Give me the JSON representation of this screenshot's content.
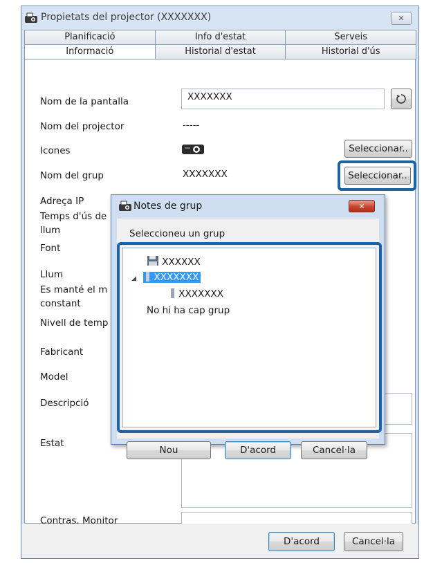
{
  "window": {
    "title": "Propietats del projector (XXXXXXX)",
    "close_glyph": "✕"
  },
  "tabs": {
    "row1": [
      "Planificació",
      "Info d'estat",
      "Serveis"
    ],
    "row2": [
      "Informació",
      "Historial d'estat",
      "Historial d'ús"
    ],
    "active": "Informació"
  },
  "info": {
    "labels": {
      "display_name": "Nom de la pantalla",
      "projector_name": "Nom del projector",
      "icons": "Icones",
      "group_name": "Nom del grup",
      "ip": "Adreça IP",
      "lamp_time_1": "Temps d'ús de",
      "lamp_time_2": "llum",
      "source": "Font",
      "lamp": "Llum",
      "constant_1": "Es manté el m",
      "constant_2": "constant",
      "temp": "Nivell de temp",
      "manufacturer": "Fabricant",
      "model": "Model",
      "description": "Descripció",
      "status": "Estat",
      "monitor_pw": "Contras. Monitor"
    },
    "values": {
      "display_name": "XXXXXXX",
      "projector_name": "-----",
      "group_name": "XXXXXXX"
    },
    "select_icon_label": "Seleccionar..",
    "select_group_label": "Seleccionar.."
  },
  "footer": {
    "ok": "D'acord",
    "cancel": "Cancel·la"
  },
  "dialog": {
    "title": "Notes de grup",
    "close_glyph": "✕",
    "prompt": "Seleccioneu un grup",
    "tree": {
      "root": "XXXXXX",
      "group_selected": "XXXXXXX",
      "child": "XXXXXXX",
      "none": "No hi ha cap grup"
    },
    "buttons": {
      "new": "Nou",
      "ok": "D'acord",
      "cancel": "Cancel·la"
    }
  },
  "colors": {
    "highlight": "#1e63a2",
    "selection": "#3399ff"
  },
  "icons": [
    "projector-icon",
    "refresh-icon",
    "floppy-icon",
    "tree-expand-icon",
    "group-bar-icon"
  ]
}
